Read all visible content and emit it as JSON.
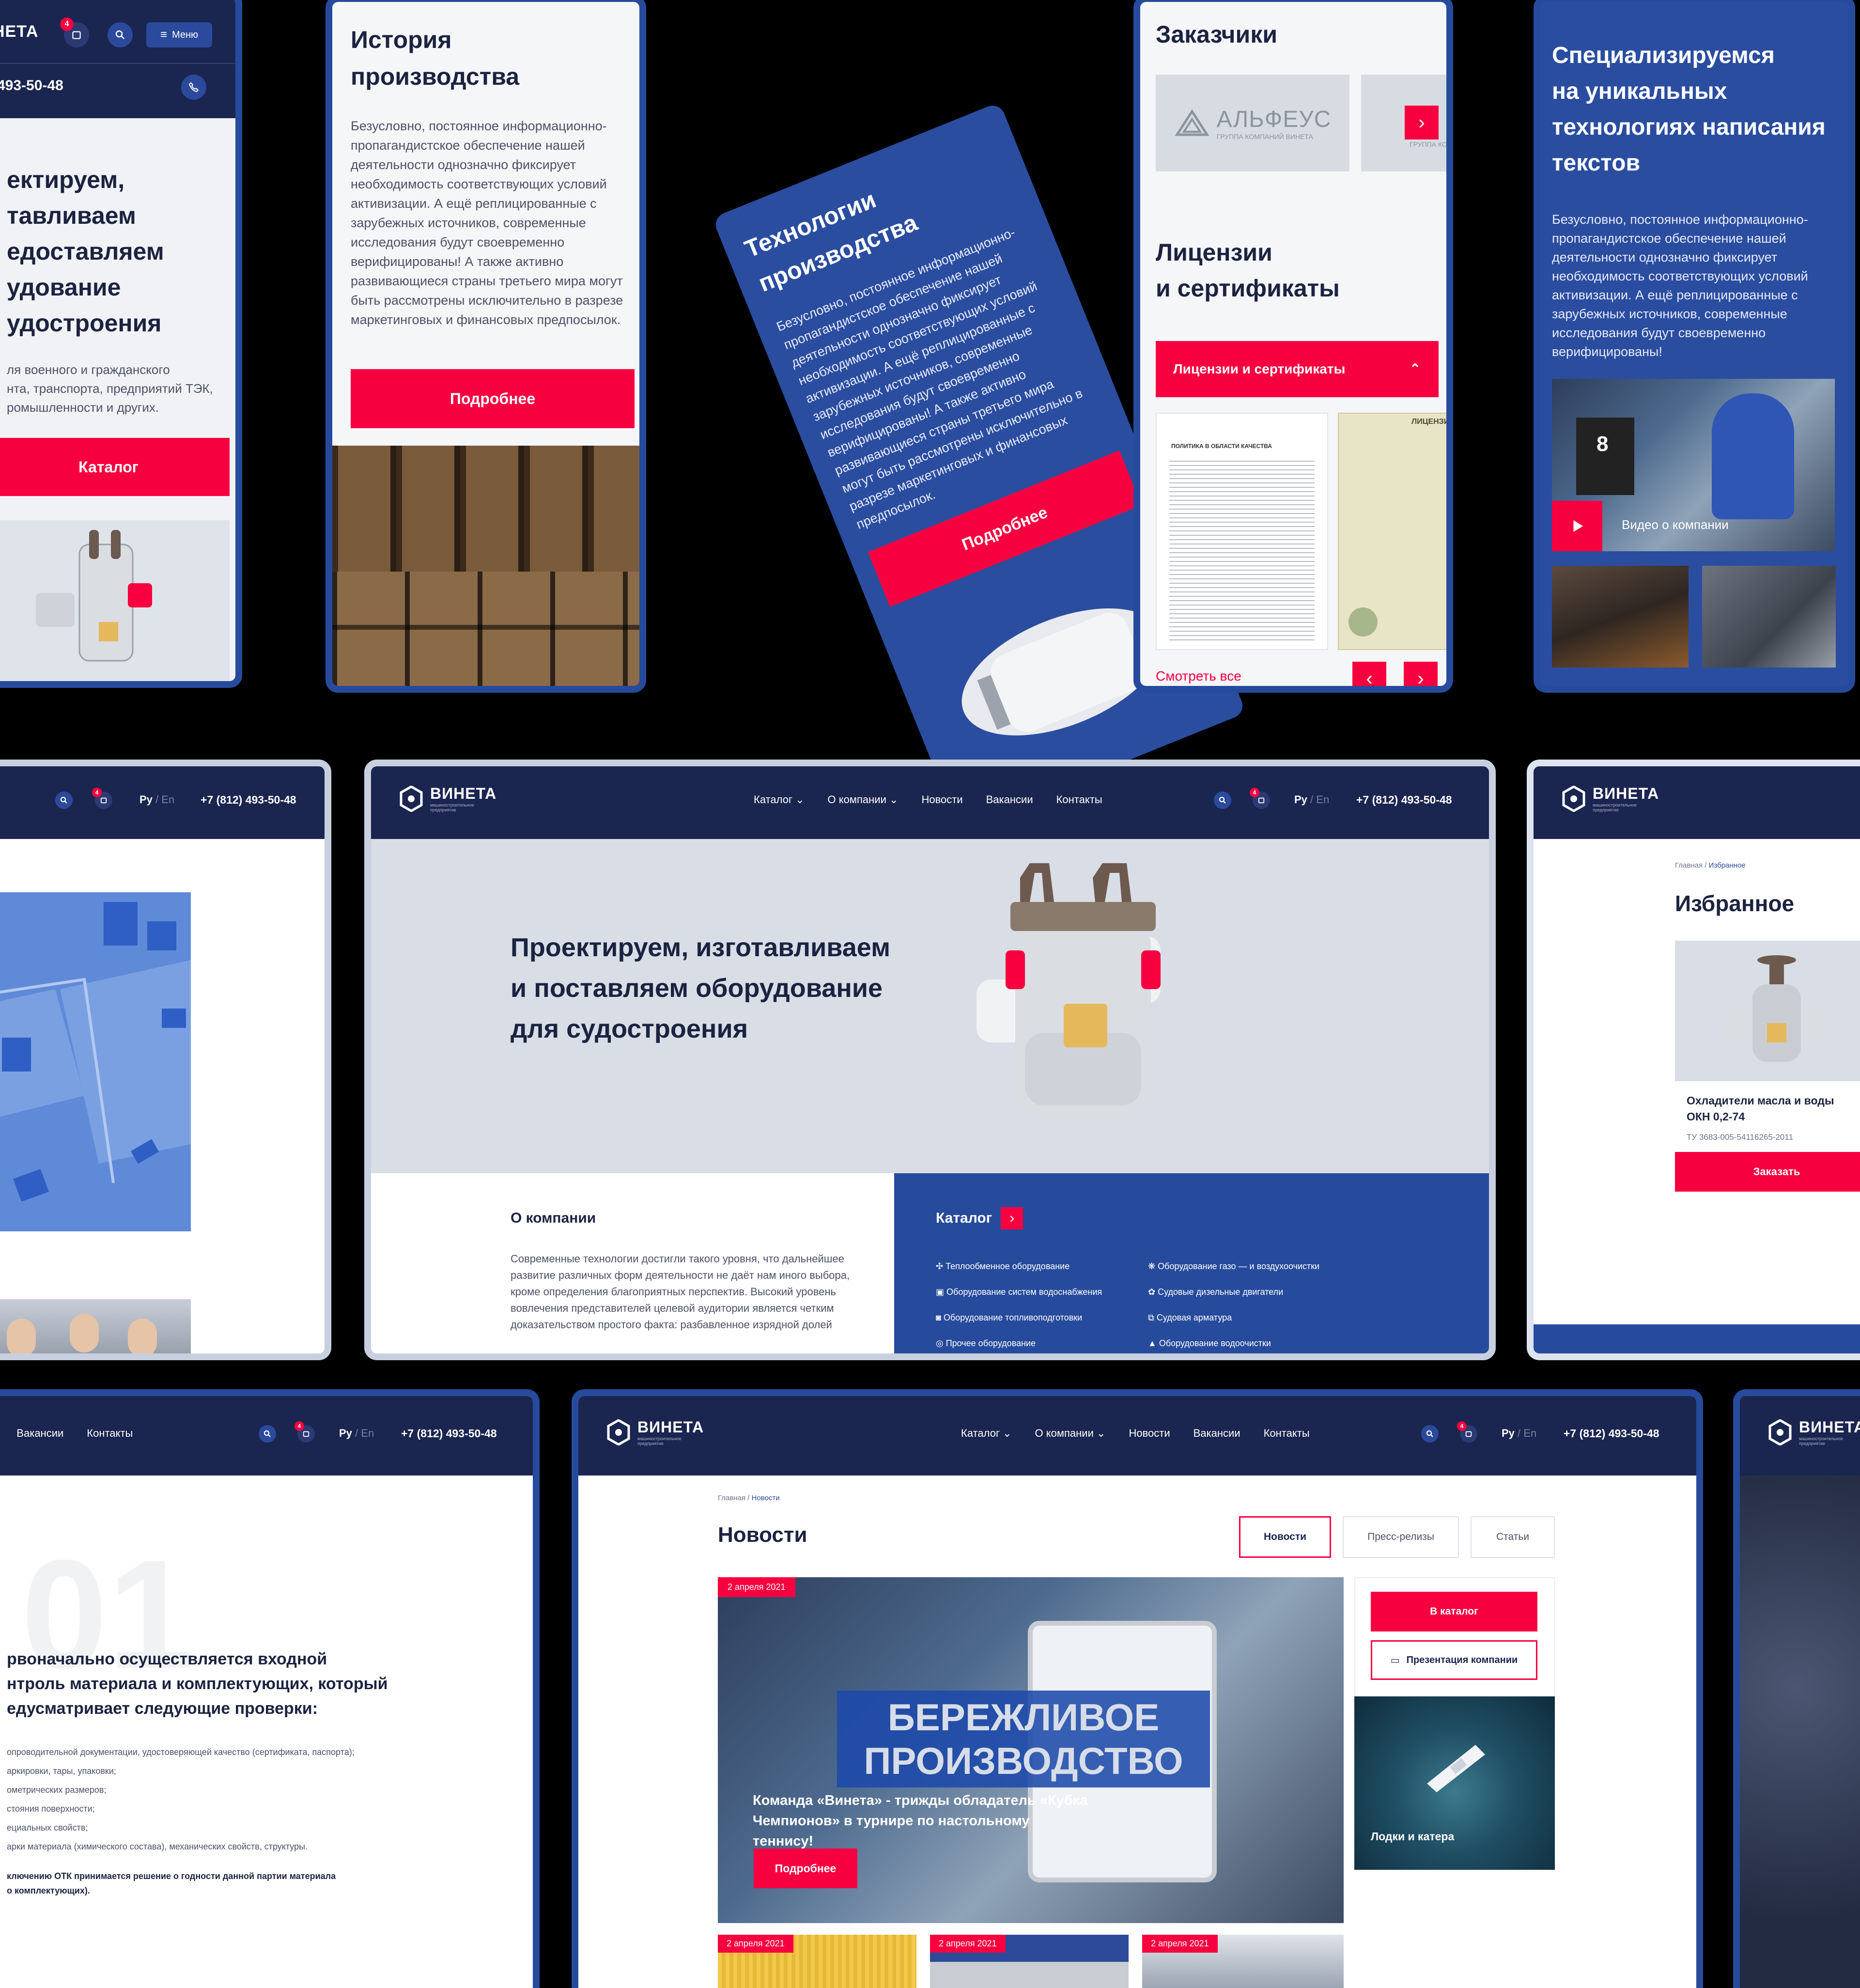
{
  "brand": {
    "name": "ВИНЕТА",
    "tagline": "машиностроительное предприятие",
    "phone": "+7 (812) 493-50-48",
    "phone_short": "493-50-48",
    "lang_ru": "Ру",
    "lang_sep": "/",
    "lang_en": "En",
    "cart_count": "4",
    "menu_label": "Меню"
  },
  "nav": {
    "catalog": "Каталог",
    "about": "О компании",
    "news": "Новости",
    "vacancies": "Вакансии",
    "contacts": "Контакты"
  },
  "mobile_hero": {
    "title_lines": [
      "ектируем,",
      "тавливаем",
      "едоставляем",
      "удование",
      "удостроения"
    ],
    "text_lines": [
      "ля военного и гражданского",
      "нта, транспорта, предприятий ТЭК,",
      "ромышленности и других."
    ],
    "button": "Каталог"
  },
  "history": {
    "title_l1": "История",
    "title_l2": "производства",
    "text": "Безусловно, постоянное информационно-пропагандистское обеспечение нашей деятельности однозначно фиксирует необходимость соответствующих условий активизации. А ещё реплицированные с зарубежных источников, современные исследования будут своевременно верифицированы! А также активно развивающиеся страны третьего мира могут быть рассмотрены исключительно в разрезе маркетинговых и финансовых предпосылок.",
    "button": "Подробнее"
  },
  "tech": {
    "title_l1": "Технологии",
    "title_l2": "производства",
    "text": "Безусловно, постоянное информационно-пропагандистское обеспечение нашей деятельности однозначно фиксирует необходимость соответствующих условий активизации. А ещё реплицированные с зарубежных источников, современные исследования будут своевременно верифицированы! А также активно развивающиеся страны третьего мира могут быть рассмотрены исключительно в разрезе маркетинговых и финансовых предпосылок.",
    "button": "Подробнее"
  },
  "customers": {
    "title": "Заказчики",
    "logo_name": "АЛЬФЕУС",
    "logo_sub": "ГРУППА КОМПАНИЙ ВИНЕТА",
    "logo_sub2": "ГРУППА КОМП",
    "licenses_l1": "Лицензии",
    "licenses_l2": "и сертификаты",
    "dropdown": "Лицензии и сертификаты",
    "cert1_title": "ПОЛИТИКА В ОБЛАСТИ КАЧЕСТВА",
    "cert2_title": "ЛИЦЕНЗИ",
    "see_all": "Смотреть все"
  },
  "special": {
    "title_lines": [
      "Специализируемся",
      "на уникальных",
      "технологиях написания",
      "текстов"
    ],
    "text": "Безусловно, постоянное информационно-пропагандистское обеспечение нашей деятельности однозначно фиксирует необходимость соответствующих условий активизации. А ещё реплицированные с зарубежных источников, современные исследования будут своевременно верифицированы!",
    "video_label": "Видео о компании",
    "photo_badge": "8"
  },
  "home": {
    "hero_title_l1": "Проектируем, изготавливаем",
    "hero_title_l2": "и поставляем оборудование",
    "hero_title_l3": "для судостроения",
    "about_title": "О компании",
    "about_text": "Современные технологии достигли такого уровня, что дальнейшее развитие различных форм деятельности не даёт нам иного выбора, кроме определения благоприятных перспектив. Высокий уровень вовлечения представителей целевой аудитории является четким доказательством простого факта: разбавленное изрядной долей",
    "catalog_title": "Каталог",
    "catalog_items_left": [
      "Теплообменное оборудование",
      "Оборудование систем водоснабжения",
      "Оборудование топливоподготовки",
      "Прочее оборудование"
    ],
    "catalog_items_right": [
      "Оборудование газо — и воздухоочистки",
      "Судовые дизельные двигатели",
      "Судовая арматура",
      "Оборудование водоочистки"
    ]
  },
  "favorites": {
    "crumb_home": "Главная",
    "crumb_sep": "/",
    "crumb_current": "Избранное",
    "title": "Избранное",
    "product_name_l1": "Охладители масла и воды",
    "product_name_l2": "ОКН 0,2-74",
    "product_code": "ТУ 3683-005-54116265-2011",
    "order_button": "Заказать"
  },
  "quality": {
    "big_number": "01",
    "heading_l1": "рвоначально осуществляется входной",
    "heading_l2": "нтроль материала и комплектующих, который",
    "heading_l3": "едусматривает следующие проверки:",
    "items": [
      "опроводительной документации, удостоверяющей качество (сертификата, паспорта);",
      "аркировки, тары, упаковки;",
      "ометрических размеров;",
      "стояния поверхности;",
      "ециальных свойств;",
      "арки материала (химического состава), механических свойств, структуры."
    ],
    "conclusion_l1": "ключению ОТК принимается решение о годности данной партии материала",
    "conclusion_l2": "о комплектующих)."
  },
  "news_page": {
    "crumb_home": "Главная",
    "crumb_sep": "/",
    "crumb_current": "Новости",
    "title": "Новости",
    "tabs": [
      "Новости",
      "Пресс-релизы",
      "Статьи"
    ],
    "main_date": "2 апреля 2021",
    "main_overlay_l1": "БЕРЕЖЛИВОЕ",
    "main_overlay_l2": "ПРОИЗВОДСТВО",
    "main_caption": "Команда «Винета» - трижды обладатель «Кубка Чемпионов» в турнире по настольному теннису!",
    "main_button": "Подробнее",
    "side_catalog_button": "В каталог",
    "side_presentation_button": "Презентация компании",
    "side_photo_caption": "Лодки и катера",
    "small_dates": [
      "2 апреля 2021",
      "2 апреля 2021",
      "2 апреля 2021"
    ]
  },
  "colors": {
    "navy": "#1a2550",
    "blue": "#274b9c",
    "red": "#f7003f",
    "light_gray": "#d8dde6"
  }
}
